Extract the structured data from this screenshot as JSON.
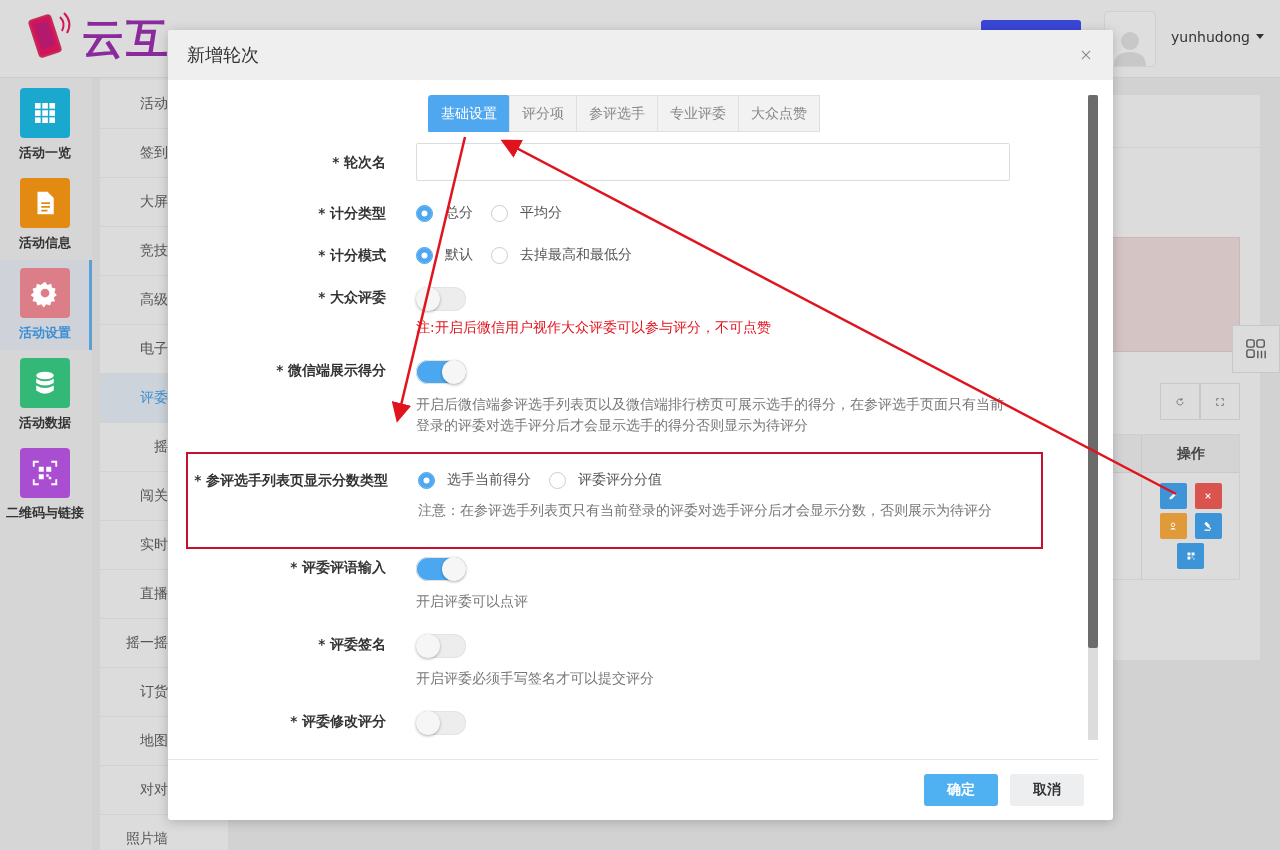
{
  "header": {
    "logo_text": "云互",
    "user": "yunhudong"
  },
  "sidebar": {
    "items": [
      {
        "label": "活动一览",
        "kind": "grid",
        "color": "#1aa8cf",
        "selected": false
      },
      {
        "label": "活动信息",
        "kind": "document",
        "color": "#e38a12",
        "selected": false
      },
      {
        "label": "活动设置",
        "kind": "gear",
        "color": "#dc7e88",
        "selected": true
      },
      {
        "label": "活动数据",
        "kind": "database",
        "color": "#34b877",
        "selected": false
      },
      {
        "label": "二维码与链接",
        "kind": "qrcode",
        "color": "#a94ed0",
        "selected": false
      }
    ]
  },
  "subnav": {
    "items": [
      {
        "label": "活动",
        "selected": false
      },
      {
        "label": "签到",
        "selected": false
      },
      {
        "label": "大屏",
        "selected": false
      },
      {
        "label": "竞技",
        "selected": false
      },
      {
        "label": "高级",
        "selected": false
      },
      {
        "label": "电子",
        "selected": false
      },
      {
        "label": "评委",
        "selected": true
      },
      {
        "label": "摇",
        "selected": false
      },
      {
        "label": "闯关",
        "selected": false
      },
      {
        "label": "实时",
        "selected": false
      },
      {
        "label": "直播",
        "selected": false
      },
      {
        "label": "摇一摇",
        "selected": false
      },
      {
        "label": "订货",
        "selected": false
      },
      {
        "label": "地图",
        "selected": false
      },
      {
        "label": "对对",
        "selected": false
      },
      {
        "label": "照片墙",
        "selected": false
      }
    ]
  },
  "panel": {
    "column_header": "操作",
    "actions": [
      {
        "kind": "edit"
      },
      {
        "kind": "delete"
      },
      {
        "kind": "person"
      },
      {
        "kind": "gavel"
      },
      {
        "kind": "qrcode"
      }
    ]
  },
  "dialog": {
    "title": "新增轮次",
    "tabs": [
      {
        "label": "基础设置",
        "selected": true
      },
      {
        "label": "评分项",
        "selected": false
      },
      {
        "label": "参评选手",
        "selected": false
      },
      {
        "label": "专业评委",
        "selected": false
      },
      {
        "label": "大众点赞",
        "selected": false
      }
    ],
    "fields": [
      {
        "kind": "text",
        "label": "* 轮次名"
      },
      {
        "kind": "radio",
        "label": "* 计分类型",
        "options": [
          {
            "label": "总分",
            "selected": true
          },
          {
            "label": "平均分",
            "selected": false
          }
        ]
      },
      {
        "kind": "radio",
        "label": "* 计分模式",
        "options": [
          {
            "label": "默认",
            "selected": true
          },
          {
            "label": "去掉最高和最低分",
            "selected": false
          }
        ]
      },
      {
        "kind": "switch",
        "label": "* 大众评委",
        "on": false,
        "note": "注:开启后微信用户视作大众评委可以参与评分，不可点赞",
        "note_warning": true
      },
      {
        "kind": "switch",
        "label": "* 微信端展示得分",
        "on": true,
        "note": "开启后微信端参评选手列表页以及微信端排行榜页可展示选手的得分，在参评选手页面只有当前登录的评委对选手评分后才会显示选手的得分否则显示为待评分"
      },
      {
        "kind": "radio",
        "label": "* 参评选手列表页显示分数类型",
        "highlighted": true,
        "options": [
          {
            "label": "选手当前得分",
            "selected": true
          },
          {
            "label": "评委评分分值",
            "selected": false
          }
        ],
        "note": "注意：在参评选手列表页只有当前登录的评委对选手评分后才会显示分数，否则展示为待评分"
      },
      {
        "kind": "switch",
        "label": "* 评委评语输入",
        "on": true,
        "note": "开启评委可以点评"
      },
      {
        "kind": "switch",
        "label": "* 评委签名",
        "on": false,
        "note": "开启评委必须手写签名才可以提交评分"
      },
      {
        "kind": "switch",
        "label": "* 评委修改评分",
        "on": false
      }
    ],
    "buttons": [
      {
        "label": "确定",
        "kind": "primary"
      },
      {
        "label": "取消",
        "kind": "default"
      }
    ]
  }
}
